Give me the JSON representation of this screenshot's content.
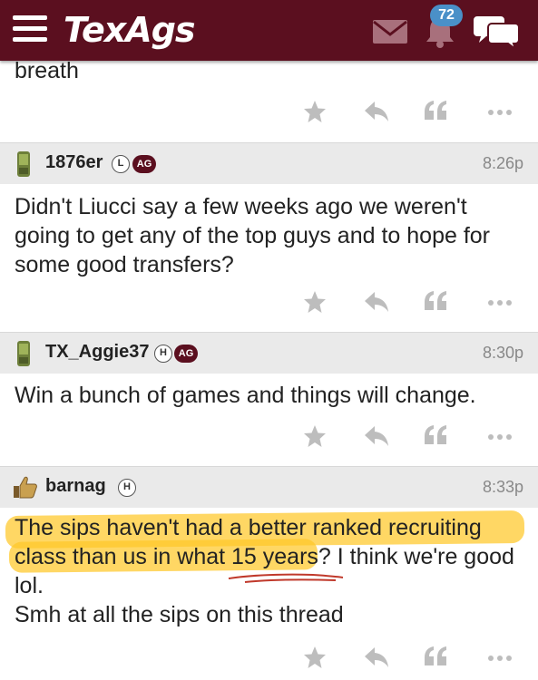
{
  "header": {
    "logo": "TexAgs",
    "notification_count": "72",
    "icons": {
      "menu": "hamburger-menu-icon",
      "mail": "envelope-icon",
      "bell": "bell-icon",
      "chat": "chat-bubbles-icon"
    },
    "colors": {
      "bar": "#5b0f1f",
      "badge": "#4a90c8"
    }
  },
  "top_fragment": {
    "text": "breath"
  },
  "posts": [
    {
      "username": "1876er",
      "badges": [
        "L",
        "AG"
      ],
      "time": "8:26p",
      "device_icon": "phone-icon",
      "body": [
        "Didn't Liucci say a few weeks ago we weren't",
        "going to get any of the top guys and to hope for",
        "some good transfers?"
      ]
    },
    {
      "username": "TX_Aggie37",
      "badges": [
        "H",
        "AG"
      ],
      "time": "8:30p",
      "device_icon": "phone-icon",
      "body": [
        "Win a bunch of games and things will change."
      ]
    },
    {
      "username": "barnag",
      "badges": [
        "H"
      ],
      "time": "8:33p",
      "device_icon": "thumbs-up-icon",
      "body": [
        "The sips haven't had a better ranked recruiting",
        "class than us in what 15 years? I think we're good",
        "lol.",
        "Smh at all the sips on this thread"
      ],
      "highlight_color": "#ffc828"
    }
  ],
  "action_icons": [
    "star-icon",
    "reply-icon",
    "quote-icon",
    "more-icon"
  ]
}
